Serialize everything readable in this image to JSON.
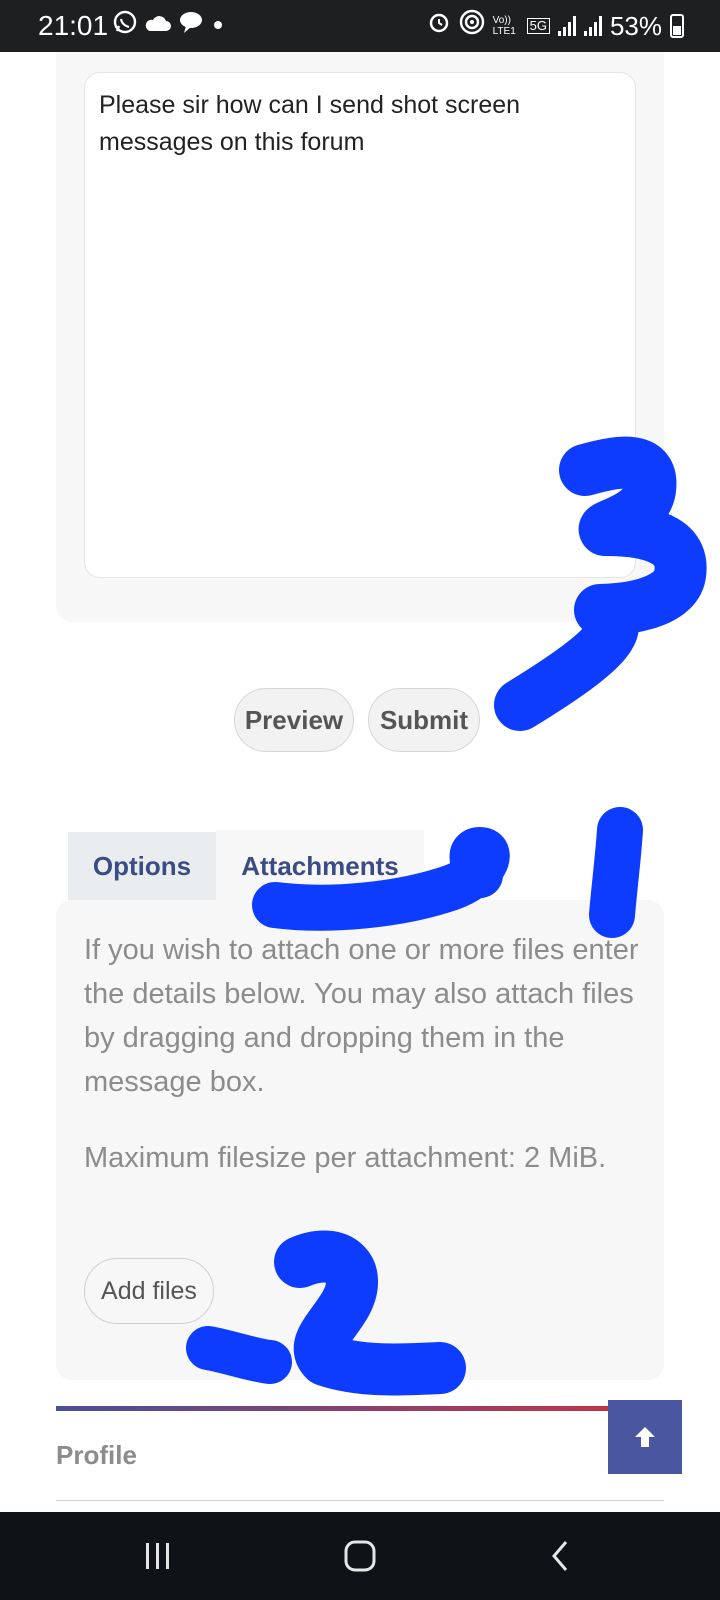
{
  "status_bar": {
    "time": "21:01",
    "left_icons": [
      "whatsapp-icon",
      "cloud-icon",
      "chat-bubble-icon",
      "dot-icon"
    ],
    "right_icons": [
      "alarm-icon",
      "hotspot-icon",
      "volte-icon",
      "5g-icon",
      "signal-icon",
      "signal-r-icon"
    ],
    "network_label": "Vo)) LTE1",
    "network_5g": "5G",
    "battery": "53%"
  },
  "editor": {
    "message_text": "Please sir how can I send shot screen messages on this forum"
  },
  "actions": {
    "preview_label": "Preview",
    "submit_label": "Submit"
  },
  "tabs": {
    "options_label": "Options",
    "attachments_label": "Attachments"
  },
  "attachments": {
    "description": "If you wish to attach one or more files enter the details below. You may also attach files by dragging and dropping them in the message box.",
    "max_size": "Maximum filesize per attachment: 2 MiB.",
    "add_files_label": "Add files"
  },
  "footer": {
    "profile_label": "Profile"
  },
  "colors": {
    "accent": "#3b4c85",
    "scroll_top_bg": "#4a56a0",
    "scribble": "#0d3cff"
  },
  "nav_bar": {
    "icons": [
      "recent-apps-icon",
      "home-icon",
      "back-icon"
    ]
  }
}
